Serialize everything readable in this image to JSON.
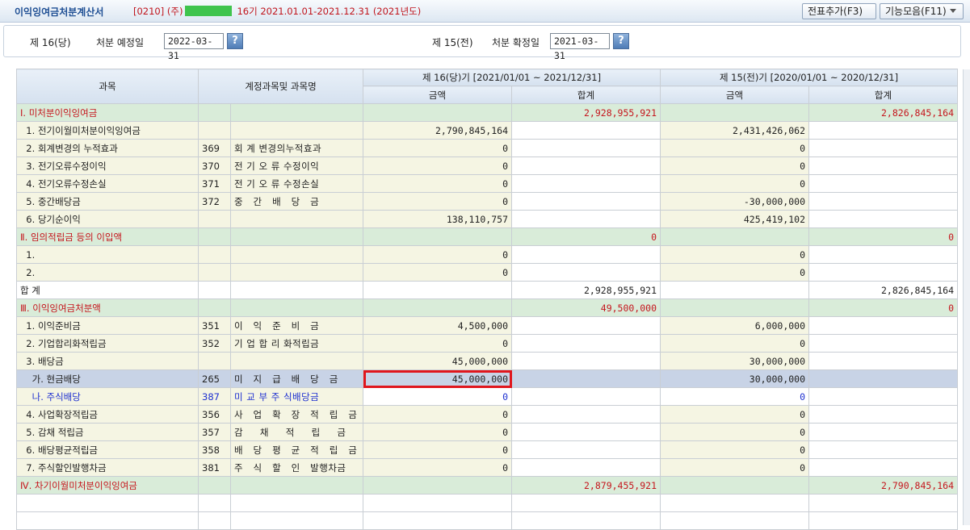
{
  "window": {
    "title": "이익잉여금처분계산서",
    "company_code": "[0210] (주)",
    "fiscal_info": "16기 2021.01.01-2021.12.31 (2021년도)",
    "btn_voucher": "전표추가(F3)",
    "btn_functions": "기능모음(F11)"
  },
  "filter": {
    "current_period_label": "제 16(당)",
    "planned_date_label": "처분 예정일",
    "planned_date": "2022-03-31",
    "prior_period_label": "제 15(전)",
    "confirmed_date_label": "처분 확정일",
    "confirmed_date": "2021-03-31",
    "help_glyph": "?"
  },
  "table": {
    "headers": {
      "subject": "과목",
      "account": "계정과목및 과목명",
      "current": "제 16(당)기 [2021/01/01 ~ 2021/12/31]",
      "prior": "제  15(전)기 [2020/01/01 ~ 2020/12/31]",
      "amount": "금액",
      "total": "합계"
    },
    "rows": [
      {
        "type": "sec",
        "subject": "Ⅰ. 미처분이익잉여금",
        "code": "",
        "account": "",
        "cur_amt": "",
        "cur_total": "2,928,955,921",
        "pri_amt": "",
        "pri_total": "2,826,845,164"
      },
      {
        "type": "norm",
        "subject": "  1. 전기이월미처분이익잉여금",
        "code": "",
        "account": "",
        "cur_amt": "2,790,845,164",
        "cur_total": "",
        "pri_amt": "2,431,426,062",
        "pri_total": ""
      },
      {
        "type": "norm",
        "subject": "  2. 회계변경의 누적효과",
        "code": "369",
        "account": "회 계 변경의누적효과",
        "cur_amt": "0",
        "cur_total": "",
        "pri_amt": "0",
        "pri_total": ""
      },
      {
        "type": "norm",
        "subject": "  3. 전기오류수정이익",
        "code": "370",
        "account": "전 기 오 류 수정이익",
        "cur_amt": "0",
        "cur_total": "",
        "pri_amt": "0",
        "pri_total": ""
      },
      {
        "type": "norm",
        "subject": "  4. 전기오류수정손실",
        "code": "371",
        "account": "전 기 오 류 수정손실",
        "cur_amt": "0",
        "cur_total": "",
        "pri_amt": "0",
        "pri_total": ""
      },
      {
        "type": "norm",
        "subject": "  5. 중간배당금",
        "code": "372",
        "account": "중   간   배   당   금",
        "cur_amt": "0",
        "cur_total": "",
        "pri_amt": "-30,000,000",
        "pri_total": ""
      },
      {
        "type": "norm",
        "subject": "  6. 당기순이익",
        "code": "",
        "account": "",
        "cur_amt": "138,110,757",
        "cur_total": "",
        "pri_amt": "425,419,102",
        "pri_total": ""
      },
      {
        "type": "sec",
        "subject": "Ⅱ. 임의적립금 등의 이입액",
        "code": "",
        "account": "",
        "cur_amt": "",
        "cur_total": "0",
        "pri_amt": "",
        "pri_total": "0"
      },
      {
        "type": "norm",
        "subject": "  1.",
        "code": "",
        "account": "",
        "cur_amt": "0",
        "cur_total": "",
        "pri_amt": "0",
        "pri_total": ""
      },
      {
        "type": "norm",
        "subject": "  2.",
        "code": "",
        "account": "",
        "cur_amt": "0",
        "cur_total": "",
        "pri_amt": "0",
        "pri_total": ""
      },
      {
        "type": "total",
        "subject": "합 계",
        "code": "",
        "account": "",
        "cur_amt": "",
        "cur_total": "2,928,955,921",
        "pri_amt": "",
        "pri_total": "2,826,845,164"
      },
      {
        "type": "sec",
        "subject": "Ⅲ. 이익잉여금처분액",
        "code": "",
        "account": "",
        "cur_amt": "",
        "cur_total": "49,500,000",
        "pri_amt": "",
        "pri_total": "0"
      },
      {
        "type": "norm",
        "subject": "  1. 이익준비금",
        "code": "351",
        "account": "이   익   준   비   금",
        "cur_amt": "4,500,000",
        "cur_total": "",
        "pri_amt": "6,000,000",
        "pri_total": ""
      },
      {
        "type": "norm",
        "subject": "  2. 기업합리화적립금",
        "code": "352",
        "account": "기 업 합 리 화적립금",
        "cur_amt": "0",
        "cur_total": "",
        "pri_amt": "0",
        "pri_total": ""
      },
      {
        "type": "norm",
        "subject": "  3. 배당금",
        "code": "",
        "account": "",
        "cur_amt": "45,000,000",
        "cur_total": "",
        "pri_amt": "30,000,000",
        "pri_total": ""
      },
      {
        "type": "sel",
        "subject": "    가. 현금배당",
        "code": "265",
        "account": "미   지   급   배   당   금",
        "cur_amt": "45,000,000",
        "cur_total": "",
        "pri_amt": "30,000,000",
        "pri_total": ""
      },
      {
        "type": "blue",
        "subject": "    나. 주식배당",
        "code": "387",
        "account": "미 교 부 주 식배당금",
        "cur_amt": "0",
        "cur_total": "",
        "pri_amt": "0",
        "pri_total": ""
      },
      {
        "type": "norm",
        "subject": "  4. 사업확장적립금",
        "code": "356",
        "account": "사   업   확   장   적   립   금",
        "cur_amt": "0",
        "cur_total": "",
        "pri_amt": "0",
        "pri_total": ""
      },
      {
        "type": "norm",
        "subject": "  5. 감채 적립금",
        "code": "357",
        "account": "감     채     적     립     금",
        "cur_amt": "0",
        "cur_total": "",
        "pri_amt": "0",
        "pri_total": ""
      },
      {
        "type": "norm",
        "subject": "  6. 배당평균적립금",
        "code": "358",
        "account": "배   당   평   균   적   립   금",
        "cur_amt": "0",
        "cur_total": "",
        "pri_amt": "0",
        "pri_total": ""
      },
      {
        "type": "norm",
        "subject": "  7. 주식할인발행차금",
        "code": "381",
        "account": "주   식   할   인   발행차금",
        "cur_amt": "0",
        "cur_total": "",
        "pri_amt": "0",
        "pri_total": ""
      },
      {
        "type": "sec",
        "subject": "Ⅳ. 차기이월미처분이익잉여금",
        "code": "",
        "account": "",
        "cur_amt": "",
        "cur_total": "2,879,455,921",
        "pri_amt": "",
        "pri_total": "2,790,845,164"
      },
      {
        "type": "empty",
        "subject": "",
        "code": "",
        "account": "",
        "cur_amt": "",
        "cur_total": "",
        "pri_amt": "",
        "pri_total": ""
      },
      {
        "type": "empty",
        "subject": "",
        "code": "",
        "account": "",
        "cur_amt": "",
        "cur_total": "",
        "pri_amt": "",
        "pri_total": ""
      }
    ],
    "highlighted_cell": {
      "row": 15,
      "column": "cur_amt"
    }
  },
  "colors": {
    "section_text": "#c5161d",
    "section_bg": "#d9ecd9",
    "row_bg": "#f5f5e3",
    "selected_bg": "#c8d3e6",
    "stock_dividend_text": "#1d2fd0",
    "highlight_box": "#e0161d",
    "title_text": "#1f4f94",
    "redacted_company_name": "#3fc44d"
  }
}
